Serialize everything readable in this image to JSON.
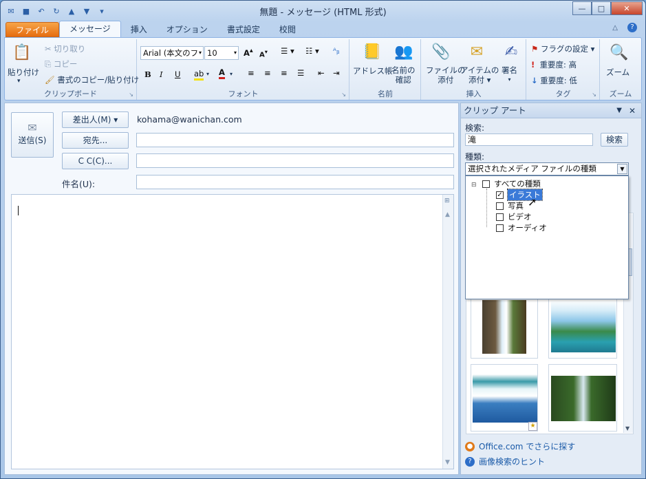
{
  "window": {
    "title": "無題 - メッセージ (HTML 形式)",
    "controls": {
      "minimize": "—",
      "maximize": "□",
      "close": "✕"
    }
  },
  "ribbon_tabs": [
    "ファイル",
    "メッセージ",
    "挿入",
    "オプション",
    "書式設定",
    "校閲"
  ],
  "ribbon": {
    "clipboard": {
      "paste": "貼り付け",
      "cut": "切り取り",
      "copy": "コピー",
      "format_painter": "書式のコピー/貼り付け",
      "label": "クリップボード"
    },
    "font": {
      "font_name": "Arial (本文のフ",
      "font_size": "10",
      "label": "フォント"
    },
    "names": {
      "address_book": "アドレス帳",
      "check_names_1": "名前の",
      "check_names_2": "確認",
      "label": "名前"
    },
    "include": {
      "attach_file_1": "ファイルの",
      "attach_file_2": "添付",
      "attach_item_1": "アイテムの",
      "attach_item_2": "添付 ▾",
      "signature": "署名",
      "label": "挿入"
    },
    "tags": {
      "followup": "フラグの設定 ▾",
      "high": "重要度: 高",
      "low": "重要度: 低",
      "label": "タグ"
    },
    "zoom": {
      "zoom": "ズーム",
      "label": "ズーム"
    }
  },
  "compose": {
    "send": "送信(S)",
    "from_button": "差出人(M) ▾",
    "from_value": "kohama@wanichan.com",
    "to_button": "宛先...",
    "cc_button": "C C(C)...",
    "subject_label": "件名(U):",
    "to_value": "",
    "cc_value": "",
    "subject_value": ""
  },
  "clipart": {
    "title": "クリップ アート",
    "search_label": "検索:",
    "search_value": "滝",
    "search_button": "検索",
    "type_label": "種類:",
    "type_value": "選択されたメディア ファイルの種類",
    "options": {
      "all": "すべての種類",
      "illustration": "イラスト",
      "photo": "写真",
      "video": "ビデオ",
      "audio": "オーディオ"
    },
    "checked": {
      "all": false,
      "illustration": true,
      "photo": false,
      "video": false,
      "audio": false
    },
    "link_office": "Office.com でさらに探す",
    "link_hint": "画像検索のヒント"
  },
  "colors": {
    "accent": "#e66d10",
    "titlebar": "#bcd3ee",
    "link": "#1a5aa8"
  },
  "icons": [
    "outlook-icon",
    "save-icon",
    "undo-icon",
    "redo-icon",
    "up-icon",
    "down-icon",
    "paste-icon",
    "scissors-icon",
    "copy-icon",
    "brush-icon",
    "address-book-icon",
    "check-names-icon",
    "paperclip-icon",
    "envelope-icon",
    "pen-icon",
    "flag-icon",
    "exclamation-icon",
    "down-arrow-icon",
    "magnifier-icon",
    "help-icon",
    "send-icon",
    "office-icon"
  ]
}
